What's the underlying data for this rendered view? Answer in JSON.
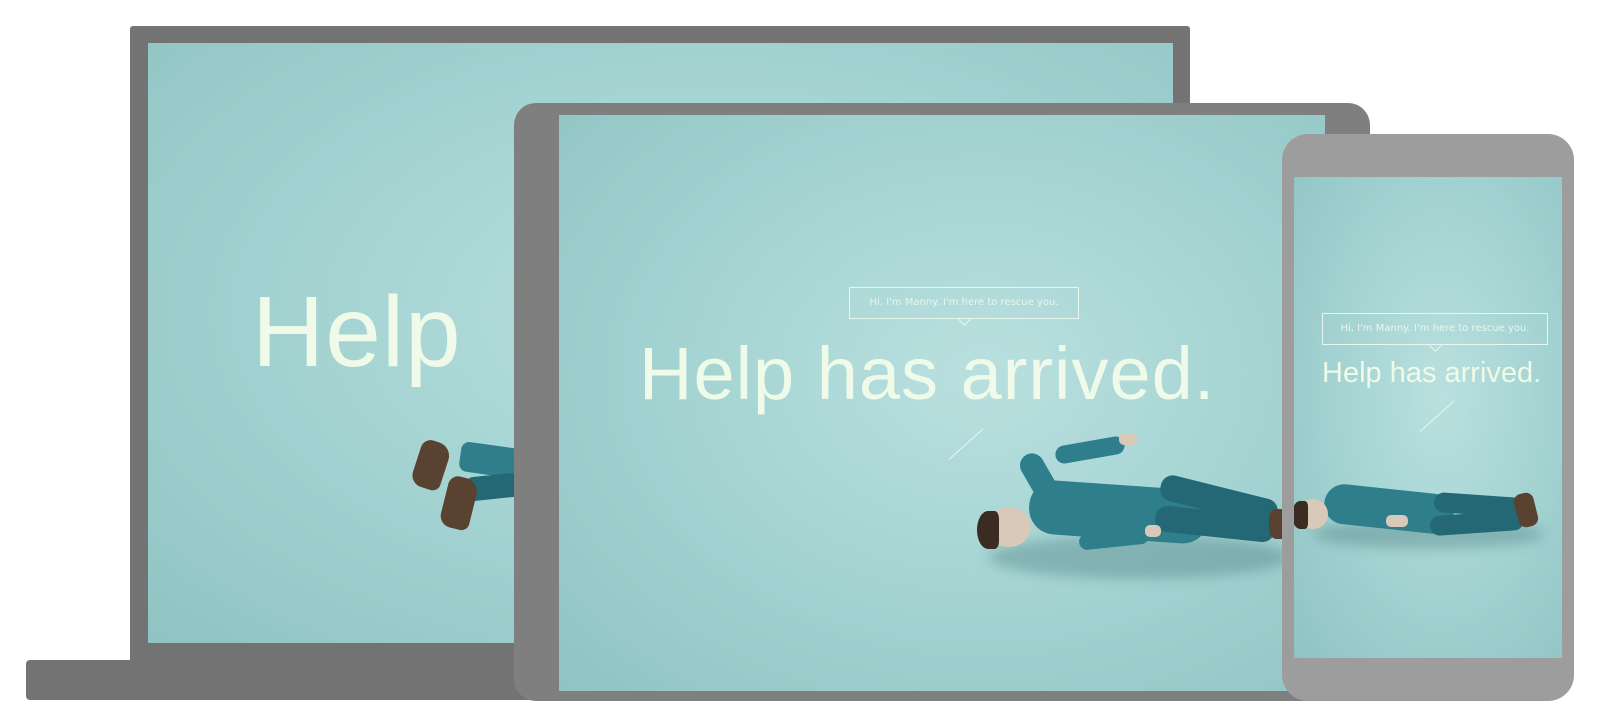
{
  "laptop": {
    "headline": "Help"
  },
  "tablet": {
    "speech_bubble": "Hi, I'm Manny. I'm here to rescue you.",
    "headline": "Help has arrived."
  },
  "phone": {
    "speech_bubble": "Hi, I'm Manny. I'm here to rescue you.",
    "headline": "Help has arrived."
  },
  "colors": {
    "screen_teal": "#a8d6d5",
    "headline": "#effbe8",
    "laptop_frame": "#737373",
    "tablet_frame": "#7f7f7f",
    "phone_frame": "#9d9d9d",
    "suit": "#2e7e8c"
  }
}
